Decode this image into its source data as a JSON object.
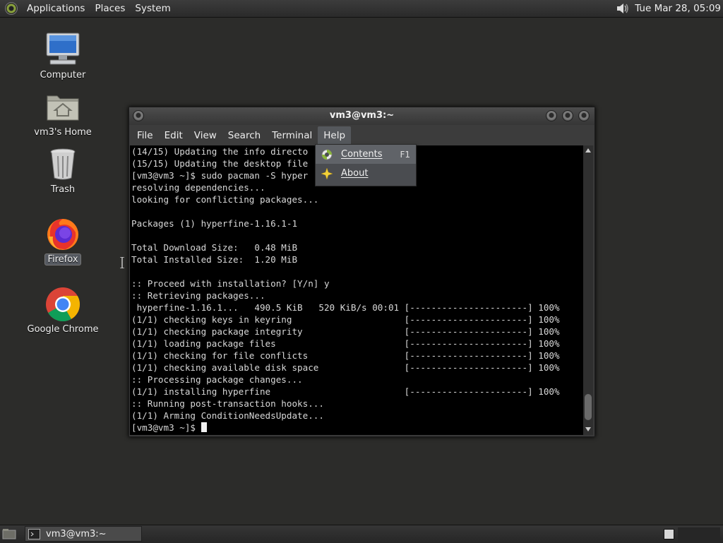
{
  "top_panel": {
    "menus": [
      "Applications",
      "Places",
      "System"
    ],
    "clock": "Tue Mar 28, 05:09"
  },
  "desktop": {
    "icons": [
      {
        "label": "Computer",
        "icon": "computer-icon"
      },
      {
        "label": "vm3's Home",
        "icon": "home-folder-icon"
      },
      {
        "label": "Trash",
        "icon": "trash-icon"
      },
      {
        "label": "Firefox",
        "icon": "firefox-icon",
        "selected": true
      },
      {
        "label": "Google Chrome",
        "icon": "chrome-icon"
      }
    ]
  },
  "terminal": {
    "title": "vm3@vm3:~",
    "menu": [
      "File",
      "Edit",
      "View",
      "Search",
      "Terminal",
      "Help"
    ],
    "lines": [
      "(14/15) Updating the info directo",
      "(15/15) Updating the desktop file",
      "[vm3@vm3 ~]$ sudo pacman -S hyper",
      "resolving dependencies...",
      "looking for conflicting packages...",
      "",
      "Packages (1) hyperfine-1.16.1-1",
      "",
      "Total Download Size:   0.48 MiB",
      "Total Installed Size:  1.20 MiB",
      "",
      ":: Proceed with installation? [Y/n] y",
      ":: Retrieving packages...",
      " hyperfine-1.16.1...   490.5 KiB   520 KiB/s 00:01 [----------------------] 100%",
      "(1/1) checking keys in keyring                     [----------------------] 100%",
      "(1/1) checking package integrity                   [----------------------] 100%",
      "(1/1) loading package files                        [----------------------] 100%",
      "(1/1) checking for file conflicts                  [----------------------] 100%",
      "(1/1) checking available disk space                [----------------------] 100%",
      ":: Processing package changes...",
      "(1/1) installing hyperfine                         [----------------------] 100%",
      ":: Running post-transaction hooks...",
      "(1/1) Arming ConditionNeedsUpdate...",
      "[vm3@vm3 ~]$ "
    ],
    "help_menu": {
      "items": [
        {
          "label": "Contents",
          "accel": "F1",
          "icon": "help-lifebuoy-icon"
        },
        {
          "label": "About",
          "icon": "about-star-icon"
        }
      ]
    }
  },
  "bottom_panel": {
    "task_label": "vm3@vm3:~"
  },
  "colors": {
    "desktop_bg": "#2c2c2a",
    "terminal_bg": "#000000",
    "terminal_fg": "#d8d8d8"
  }
}
